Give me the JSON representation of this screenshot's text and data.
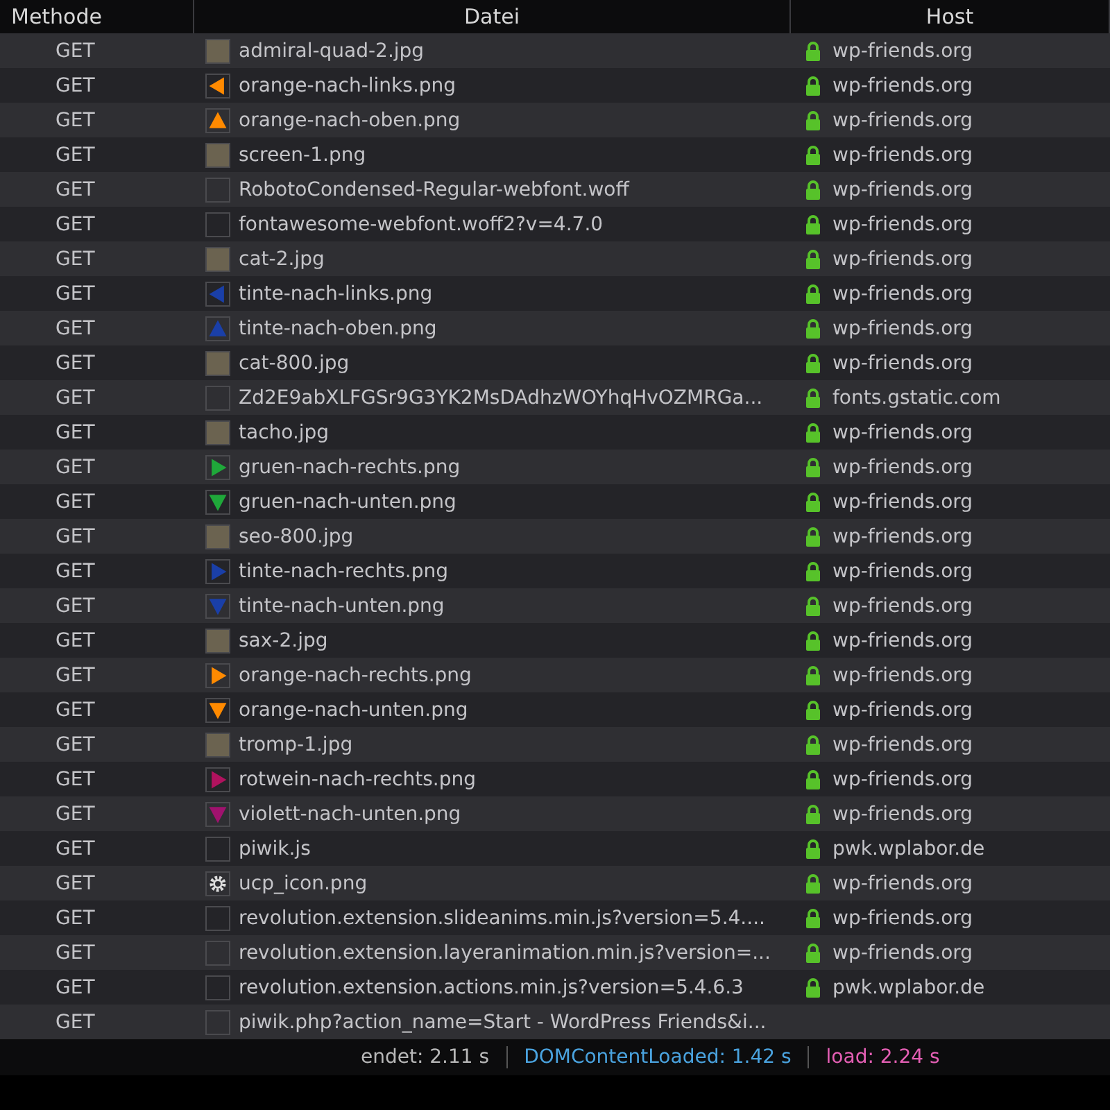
{
  "table": {
    "columns": [
      "Methode",
      "Datei",
      "Host"
    ],
    "rows": [
      {
        "method": "GET",
        "file": "admiral-quad-2.jpg",
        "thumb": {
          "kind": "photo"
        },
        "host": "wp-friends.org",
        "secure": true
      },
      {
        "method": "GET",
        "file": "orange-nach-links.png",
        "thumb": {
          "kind": "arrow-left",
          "color": "#ff8a00"
        },
        "host": "wp-friends.org",
        "secure": true
      },
      {
        "method": "GET",
        "file": "orange-nach-oben.png",
        "thumb": {
          "kind": "arrow-up",
          "color": "#ff8a00"
        },
        "host": "wp-friends.org",
        "secure": true
      },
      {
        "method": "GET",
        "file": "screen-1.png",
        "thumb": {
          "kind": "photo"
        },
        "host": "wp-friends.org",
        "secure": true
      },
      {
        "method": "GET",
        "file": "RobotoCondensed-Regular-webfont.woff",
        "thumb": {
          "kind": "blank"
        },
        "host": "wp-friends.org",
        "secure": true
      },
      {
        "method": "GET",
        "file": "fontawesome-webfont.woff2?v=4.7.0",
        "thumb": {
          "kind": "blank"
        },
        "host": "wp-friends.org",
        "secure": true
      },
      {
        "method": "GET",
        "file": "cat-2.jpg",
        "thumb": {
          "kind": "photo"
        },
        "host": "wp-friends.org",
        "secure": true
      },
      {
        "method": "GET",
        "file": "tinte-nach-links.png",
        "thumb": {
          "kind": "arrow-left",
          "color": "#1a3fa8"
        },
        "host": "wp-friends.org",
        "secure": true
      },
      {
        "method": "GET",
        "file": "tinte-nach-oben.png",
        "thumb": {
          "kind": "arrow-up",
          "color": "#1a3fa8"
        },
        "host": "wp-friends.org",
        "secure": true
      },
      {
        "method": "GET",
        "file": "cat-800.jpg",
        "thumb": {
          "kind": "photo"
        },
        "host": "wp-friends.org",
        "secure": true
      },
      {
        "method": "GET",
        "file": "Zd2E9abXLFGSr9G3YK2MsDAdhzWOYhqHvOZMRGa...",
        "thumb": {
          "kind": "blank"
        },
        "host": "fonts.gstatic.com",
        "secure": true
      },
      {
        "method": "GET",
        "file": "tacho.jpg",
        "thumb": {
          "kind": "photo"
        },
        "host": "wp-friends.org",
        "secure": true
      },
      {
        "method": "GET",
        "file": "gruen-nach-rechts.png",
        "thumb": {
          "kind": "arrow-right",
          "color": "#1fa83a"
        },
        "host": "wp-friends.org",
        "secure": true
      },
      {
        "method": "GET",
        "file": "gruen-nach-unten.png",
        "thumb": {
          "kind": "arrow-down",
          "color": "#1fa83a"
        },
        "host": "wp-friends.org",
        "secure": true
      },
      {
        "method": "GET",
        "file": "seo-800.jpg",
        "thumb": {
          "kind": "photo"
        },
        "host": "wp-friends.org",
        "secure": true
      },
      {
        "method": "GET",
        "file": "tinte-nach-rechts.png",
        "thumb": {
          "kind": "arrow-right",
          "color": "#1a3fa8"
        },
        "host": "wp-friends.org",
        "secure": true
      },
      {
        "method": "GET",
        "file": "tinte-nach-unten.png",
        "thumb": {
          "kind": "arrow-down",
          "color": "#1a3fa8"
        },
        "host": "wp-friends.org",
        "secure": true
      },
      {
        "method": "GET",
        "file": "sax-2.jpg",
        "thumb": {
          "kind": "photo"
        },
        "host": "wp-friends.org",
        "secure": true
      },
      {
        "method": "GET",
        "file": "orange-nach-rechts.png",
        "thumb": {
          "kind": "arrow-right",
          "color": "#ff8a00"
        },
        "host": "wp-friends.org",
        "secure": true
      },
      {
        "method": "GET",
        "file": "orange-nach-unten.png",
        "thumb": {
          "kind": "arrow-down",
          "color": "#ff8a00"
        },
        "host": "wp-friends.org",
        "secure": true
      },
      {
        "method": "GET",
        "file": "tromp-1.jpg",
        "thumb": {
          "kind": "photo"
        },
        "host": "wp-friends.org",
        "secure": true
      },
      {
        "method": "GET",
        "file": "rotwein-nach-rechts.png",
        "thumb": {
          "kind": "arrow-right",
          "color": "#b0125e"
        },
        "host": "wp-friends.org",
        "secure": true
      },
      {
        "method": "GET",
        "file": "violett-nach-unten.png",
        "thumb": {
          "kind": "arrow-down",
          "color": "#a0126e"
        },
        "host": "wp-friends.org",
        "secure": true
      },
      {
        "method": "GET",
        "file": "piwik.js",
        "thumb": {
          "kind": "blank"
        },
        "host": "pwk.wplabor.de",
        "secure": true
      },
      {
        "method": "GET",
        "file": "ucp_icon.png",
        "thumb": {
          "kind": "gear"
        },
        "host": "wp-friends.org",
        "secure": true
      },
      {
        "method": "GET",
        "file": "revolution.extension.slideanims.min.js?version=5.4....",
        "thumb": {
          "kind": "blank"
        },
        "host": "wp-friends.org",
        "secure": true
      },
      {
        "method": "GET",
        "file": "revolution.extension.layeranimation.min.js?version=...",
        "thumb": {
          "kind": "blank"
        },
        "host": "wp-friends.org",
        "secure": true
      },
      {
        "method": "GET",
        "file": "revolution.extension.actions.min.js?version=5.4.6.3",
        "thumb": {
          "kind": "blank"
        },
        "host": "pwk.wplabor.de",
        "secure": true
      },
      {
        "method": "GET",
        "file": "piwik.php?action_name=Start - WordPress Friends&i...",
        "thumb": {
          "kind": "blank"
        }
      }
    ]
  },
  "status_bar": [
    {
      "text": "endet: 2.11 s",
      "color": "#b8b8b8"
    },
    {
      "text": "DOMContentLoaded: 1.42 s",
      "color": "#4aa3df"
    },
    {
      "text": "load: 2.24 s",
      "color": "#e45fb4"
    }
  ]
}
